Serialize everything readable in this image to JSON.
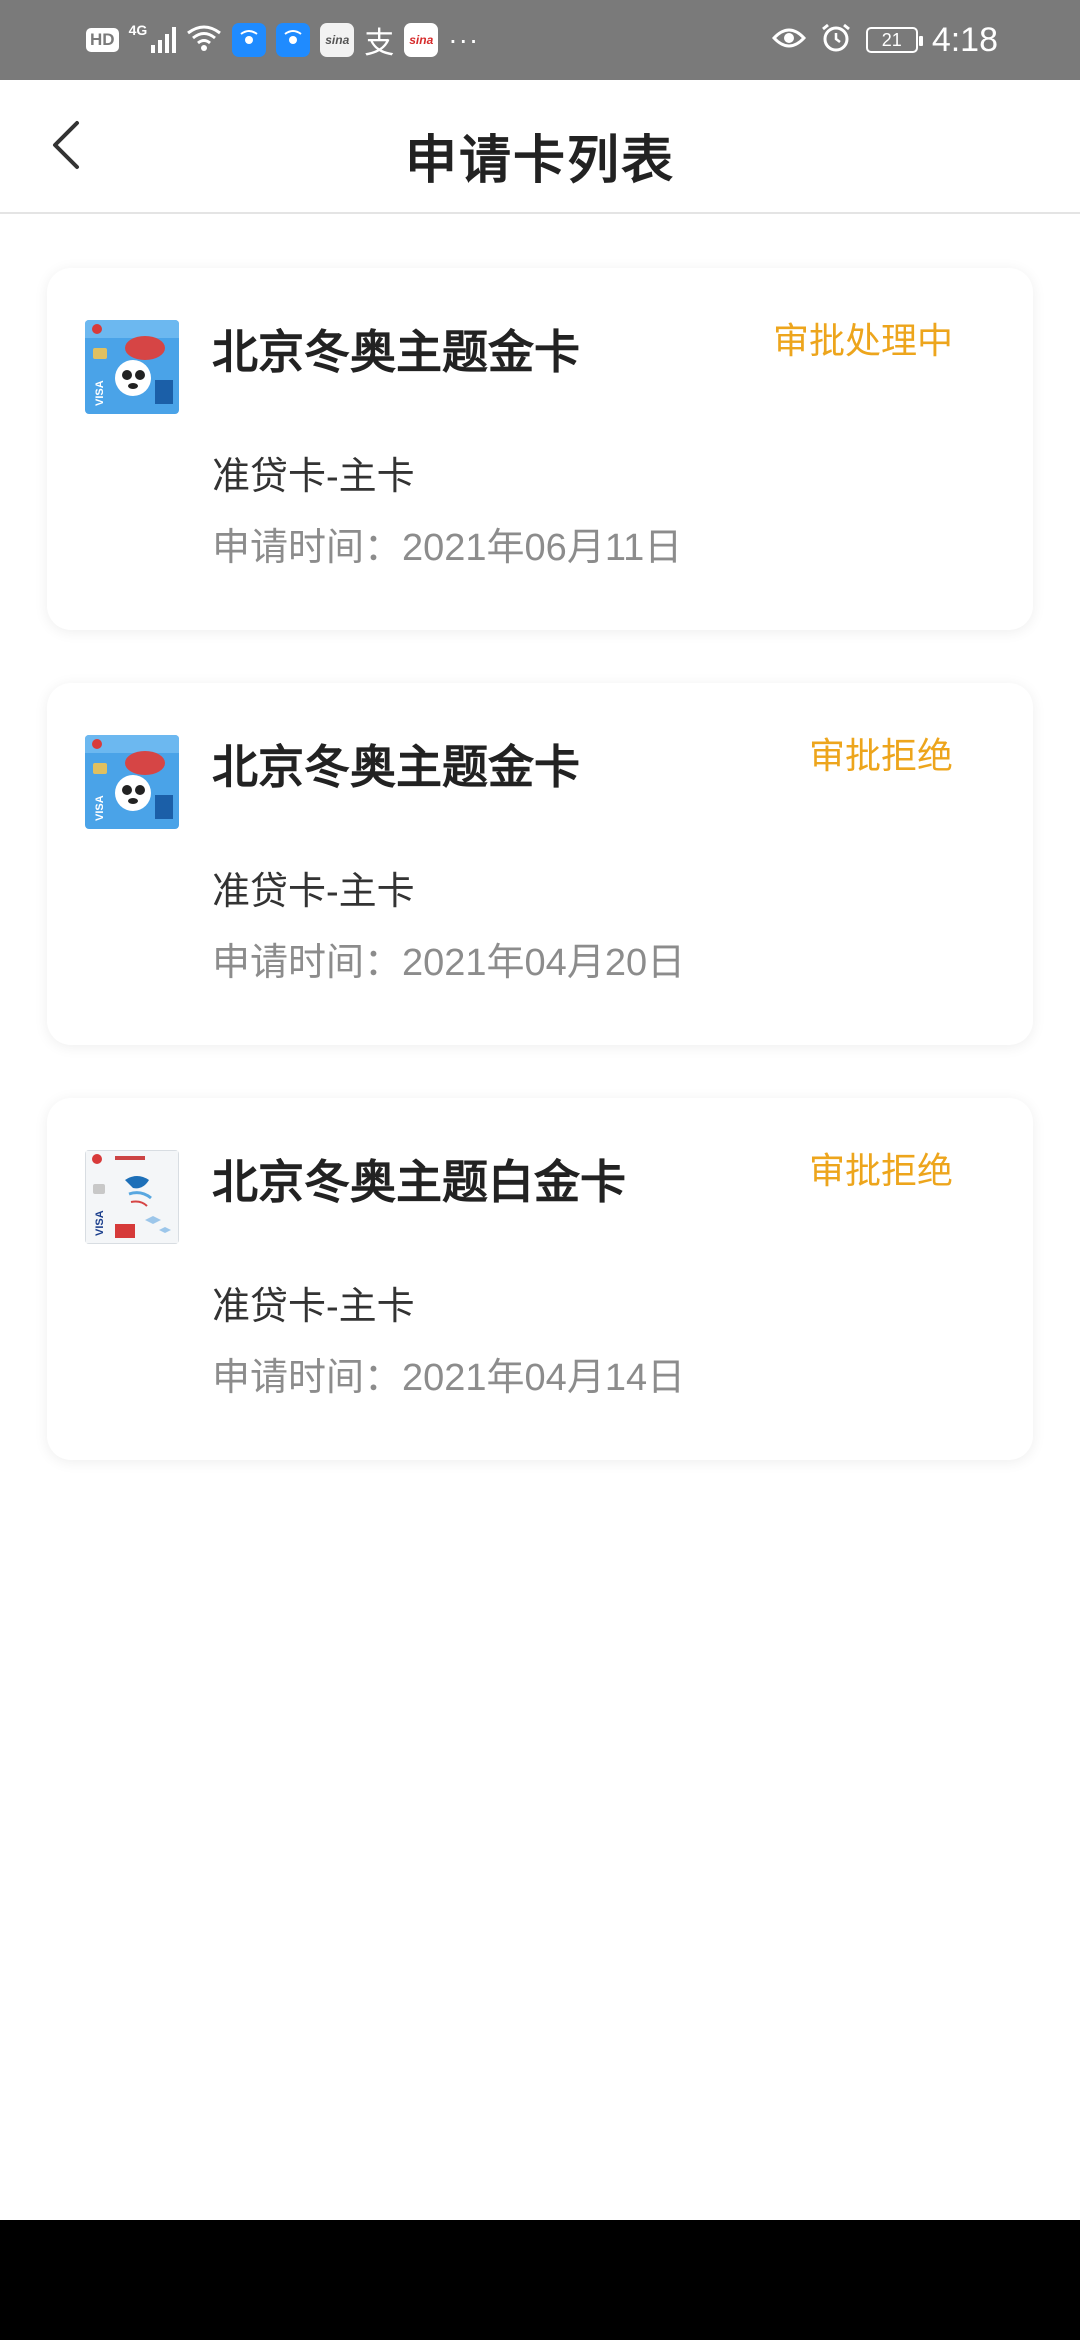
{
  "status_bar": {
    "hd": "HD",
    "network": "4G",
    "apps": [
      "wifi-assist-icon",
      "wifi-assist-icon",
      "sina-icon",
      "alipay-icon",
      "sina-news-icon"
    ],
    "zhi": "支",
    "sina1": "sina",
    "sina2": "sina",
    "more": "···",
    "battery": "21",
    "time": "4:18"
  },
  "header": {
    "title": "申请卡列表",
    "back_icon": "chevron-left-icon"
  },
  "cards": [
    {
      "name": "北京冬奥主题金卡",
      "status": "审批处理中",
      "type": "准贷卡-主卡",
      "date_label": "申请时间：",
      "date": "2021年06月11日",
      "theme": "gold"
    },
    {
      "name": "北京冬奥主题金卡",
      "status": "审批拒绝",
      "type": "准贷卡-主卡",
      "date_label": "申请时间：",
      "date": "2021年04月20日",
      "theme": "gold"
    },
    {
      "name": "北京冬奥主题白金卡",
      "status": "审批拒绝",
      "type": "准贷卡-主卡",
      "date_label": "申请时间：",
      "date": "2021年04月14日",
      "theme": "platinum"
    }
  ],
  "colors": {
    "status": "#eda51c",
    "title": "#222222",
    "secondary": "#8c8c8c"
  }
}
